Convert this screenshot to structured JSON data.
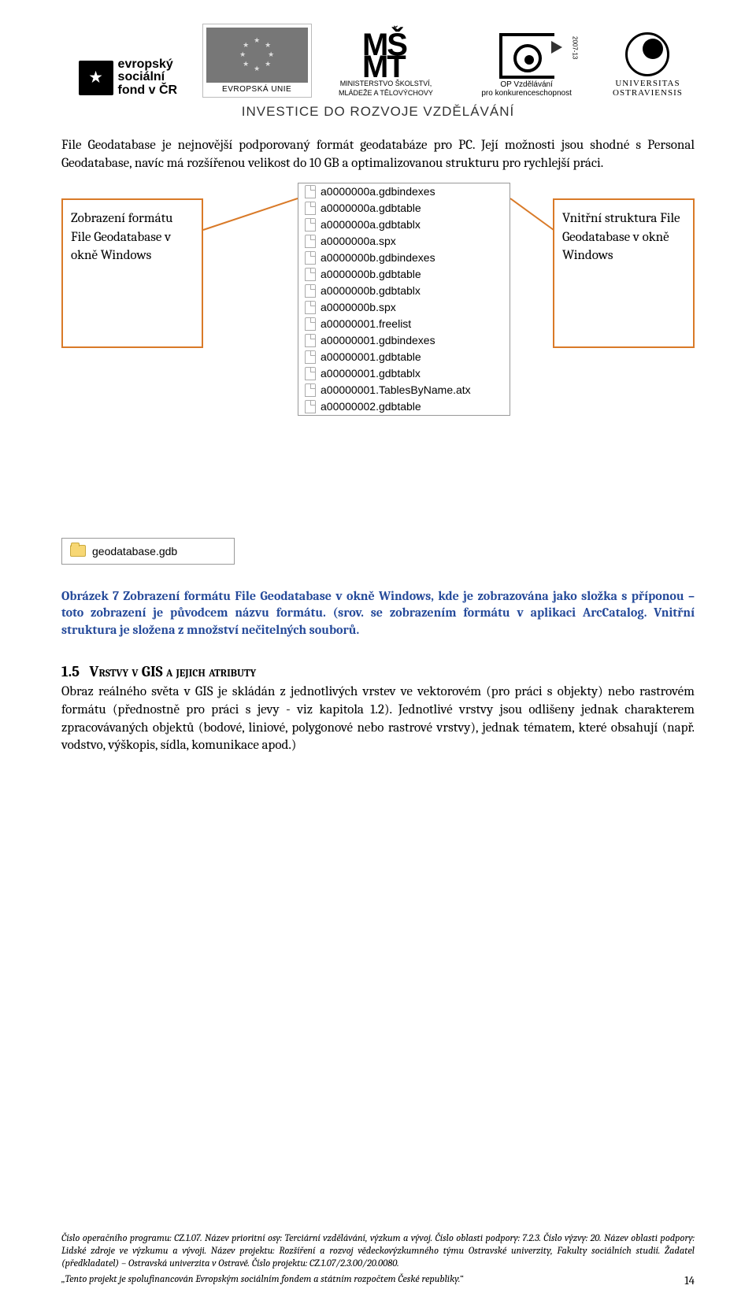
{
  "header": {
    "esf_line1": "evropský",
    "esf_line2": "sociální",
    "esf_line3": "fond v ČR",
    "eu_label": "EVROPSKÁ UNIE",
    "msmt_line1": "MINISTERSTVO ŠKOLSTVÍ,",
    "msmt_line2": "MLÁDEŽE A TĚLOVÝCHOVY",
    "op_line1": "OP Vzdělávání",
    "op_line2": "pro konkurenceschopnost",
    "op_years": "2007-13",
    "uni_line1": "UNIVERSITAS",
    "uni_line2": "OSTRAVIENSIS",
    "investice": "INVESTICE DO ROZVOJE VZDĚLÁVÁNÍ"
  },
  "intro_para": "File Geodatabase je nejnovější podporovaný formát geodatabáze pro PC. Její možnosti jsou shodné s Personal Geodatabase, navíc má rozšířenou velikost do 10 GB a optimalizovanou strukturu pro rychlejší práci.",
  "annot_left": "Zobrazení formátu File Geodatabase v okně Windows",
  "annot_right": "Vnitřní struktura File Geodatabase v okně Windows",
  "filelist": [
    "a0000000a.gdbindexes",
    "a0000000a.gdbtable",
    "a0000000a.gdbtablx",
    "a0000000a.spx",
    "a0000000b.gdbindexes",
    "a0000000b.gdbtable",
    "a0000000b.gdbtablx",
    "a0000000b.spx",
    "a00000001.freelist",
    "a00000001.gdbindexes",
    "a00000001.gdbtable",
    "a00000001.gdbtablx",
    "a00000001.TablesByName.atx",
    "a00000002.gdbtable"
  ],
  "folder_name": "geodatabase.gdb",
  "caption": "Obrázek 7 Zobrazení formátu File Geodatabase v okně Windows, kde je zobrazována jako složka s příponou – toto zobrazení je původcem názvu formátu. (srov. se zobrazením formátu v aplikaci ArcCatalog. Vnitřní struktura je složena z množství nečitelných souborů.",
  "section": {
    "num": "1.5",
    "title": "Vrstvy v GIS a jejich atributy",
    "body": "Obraz reálného světa v GIS je skládán z jednotlivých vrstev ve vektorovém (pro práci s objekty) nebo rastrovém formátu (přednostně pro práci s jevy - viz kapitola 1.2). Jednotlivé vrstvy jsou odlišeny jednak charakterem zpracovávaných objektů (bodové, liniové, polygonové nebo rastrové vrstvy), jednak tématem, které obsahují (např. vodstvo, výškopis, sídla, komunikace apod.)"
  },
  "footer": {
    "meta": "Číslo operačního programu: CZ.1.07. Název prioritní osy: Terciární vzdělávání, výzkum a vývoj. Číslo oblasti podpory: 7.2.3. Číslo výzvy: 20. Název oblasti podpory: Lidské zdroje ve výzkumu a vývoji. Název projektu: Rozšíření a rozvoj vědeckovýzkumného týmu Ostravské univerzity, Fakulty sociálních studií. Žadatel (předkladatel) – Ostravská univerzita v Ostravě. Číslo projektu: CZ.1.07/2.3.00/20.0080.",
    "credit": "„Tento projekt je spolufinancován Evropským sociálním fondem a státním rozpočtem České republiky.“",
    "page": "14"
  }
}
